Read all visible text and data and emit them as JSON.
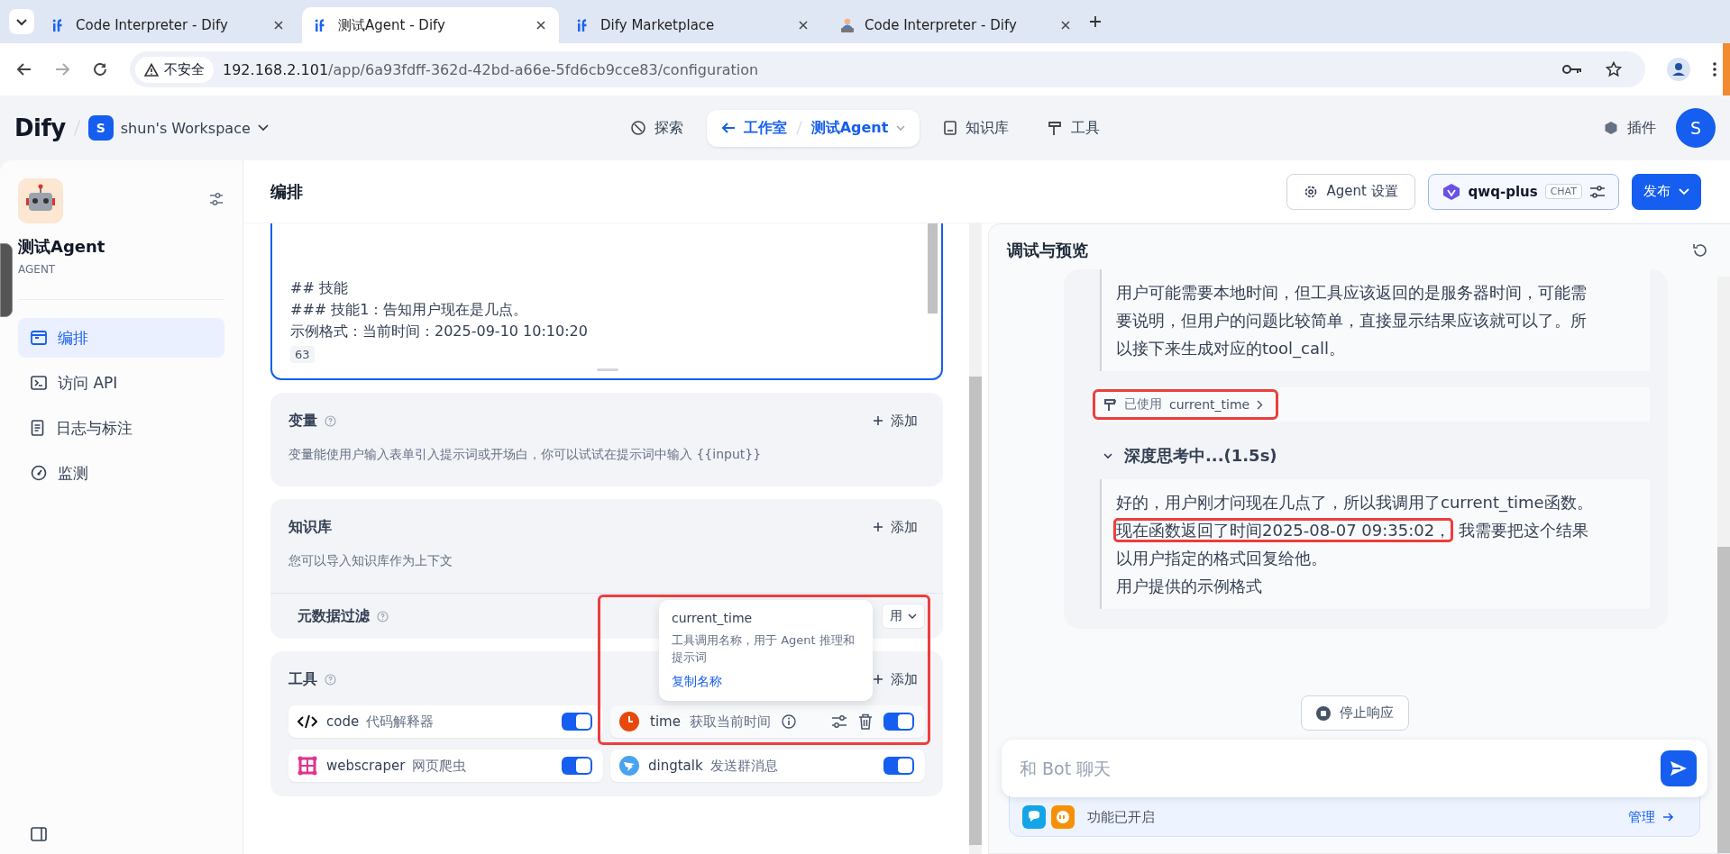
{
  "browser": {
    "tabs": [
      {
        "title": "Code Interpreter - Dify",
        "selected": false,
        "kind": "dify"
      },
      {
        "title": "测试Agent - Dify",
        "selected": true,
        "kind": "dify"
      },
      {
        "title": "Dify Marketplace",
        "selected": false,
        "kind": "dify"
      },
      {
        "title": "Code Interpreter - Dify",
        "selected": false,
        "kind": "person"
      }
    ],
    "security": "不安全",
    "host": "192.168.2.101",
    "path": "/app/6a93fdff-362d-42bd-a66e-5fd6cb9cce83/configuration"
  },
  "header": {
    "logo": "Dify",
    "workspace_initial": "S",
    "workspace": "shun's Workspace",
    "nav": [
      {
        "kind": "explore",
        "label": "探索",
        "selected": false
      },
      {
        "kind": "studio",
        "label": "工作室",
        "app": "测试Agent",
        "selected": true
      },
      {
        "kind": "datasets",
        "label": "知识库",
        "selected": false
      },
      {
        "kind": "tools",
        "label": "工具",
        "selected": false
      }
    ],
    "plugins": "插件",
    "avatar": "S"
  },
  "sidebar": {
    "app_name": "测试Agent",
    "app_type": "AGENT",
    "items": [
      {
        "kind": "orchestrate",
        "label": "编排",
        "selected": true
      },
      {
        "kind": "api",
        "label": "访问 API",
        "selected": false
      },
      {
        "kind": "logs",
        "label": "日志与标注",
        "selected": false
      },
      {
        "kind": "monitor",
        "label": "监测",
        "selected": false
      }
    ]
  },
  "main": {
    "title": "编排",
    "agent_settings": "Agent 设置",
    "model": "qwq-plus",
    "model_tag": "CHAT",
    "publish": "发布",
    "prompt": {
      "lines": [
        "## 技能",
        "### 技能1：告知用户现在是几点。",
        "示例格式：当前时间：2025-09-10 10:10:20"
      ],
      "count": "63"
    },
    "variables": {
      "title": "变量",
      "add": "添加",
      "description": "变量能使用户输入表单引入提示词或开场白，你可以试试在提示词中输入 {{input}}"
    },
    "knowledge": {
      "title": "知识库",
      "add": "添加",
      "description": "您可以导入知识库作为上下文",
      "filter_label": "元数据过滤",
      "filter_value": "用"
    },
    "tools": {
      "title": "工具",
      "add": "添加",
      "items": [
        {
          "kind": "code",
          "name": "code",
          "description": "代码解释器",
          "on": true,
          "hovered": false
        },
        {
          "kind": "clock",
          "name": "time",
          "description": "获取当前时间",
          "on": true,
          "hovered": true
        },
        {
          "kind": "web",
          "name": "webscraper",
          "description": "网页爬虫",
          "on": true,
          "hovered": false
        },
        {
          "kind": "ding",
          "name": "dingtalk",
          "description": "发送群消息",
          "on": true,
          "hovered": false
        }
      ]
    },
    "tooltip": {
      "name": "current_time",
      "description": "工具调用名称，用于 Agent 推理和提示词",
      "action": "复制名称",
      "highlighted": true
    }
  },
  "preview": {
    "title": "调试与预览",
    "thought": "用户可能需要本地时间，但工具应该返回的是服务器时间，可能需要说明，但用户的问题比较简单，直接显示结果应该就可以了。所以接下来生成对应的tool_call。",
    "tool_used": {
      "label": "已使用",
      "name": "current_time",
      "highlighted": true
    },
    "thinking": {
      "title": "深度思考中...(1.5s)",
      "expanded": true,
      "paragraphs": [
        [
          {
            "text": "好的，用户刚才问现在几点了，所以我调用了current_time函数。",
            "highlighted": false
          },
          {
            "text": "现在函数返回了时间2025-08-07 09:35:02，",
            "highlighted": true
          },
          {
            "text": "我需要把这个结果以用户指定的格式回复给他。",
            "highlighted": false
          }
        ],
        [
          {
            "text": "用户提供的示例格式",
            "highlighted": false
          }
        ]
      ]
    },
    "stop": "停止响应",
    "placeholder": "和 Bot 聊天",
    "features": "功能已开启",
    "manage": "管理"
  }
}
